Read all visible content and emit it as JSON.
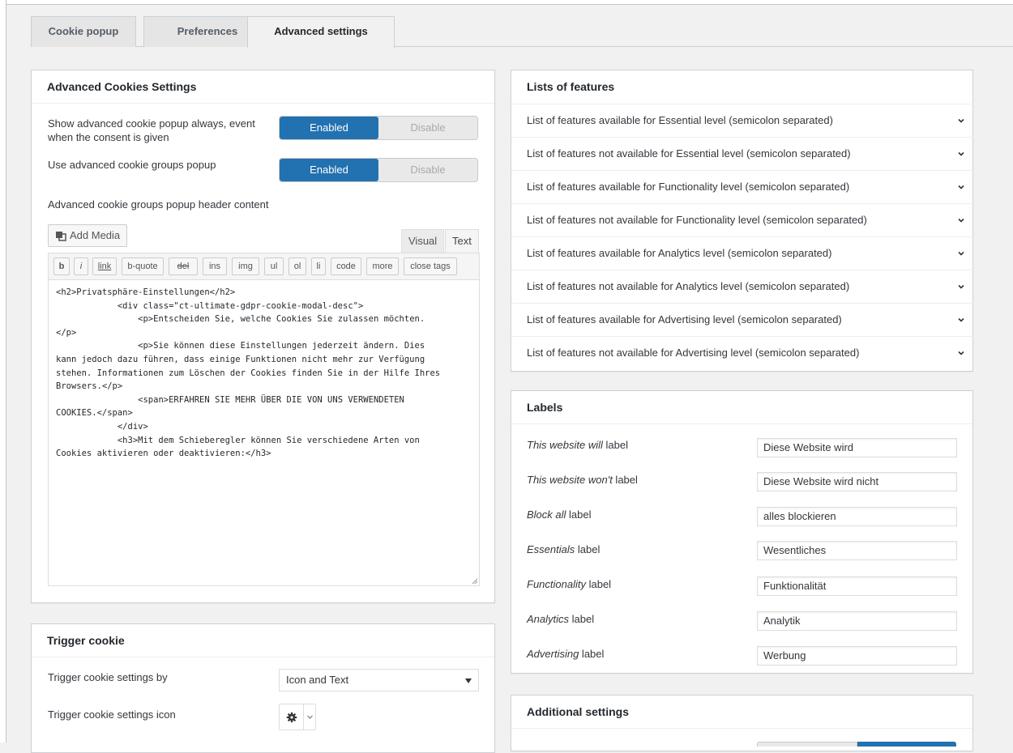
{
  "tabs": [
    {
      "label": "Cookie popup",
      "active": false
    },
    {
      "label": "Preferences",
      "active": false
    },
    {
      "label": "Advanced settings",
      "active": true
    }
  ],
  "advanced_box": {
    "title": "Advanced Cookies Settings",
    "show_popup_always": {
      "label": "Show advanced cookie popup always, event when the consent is given",
      "on_label": "Enabled",
      "off_label": "Disable",
      "value": "Enabled"
    },
    "use_groups_popup": {
      "label": "Use advanced cookie groups popup",
      "on_label": "Enabled",
      "off_label": "Disable",
      "value": "Enabled"
    },
    "header_content_label": "Advanced cookie groups popup header content",
    "editor": {
      "add_media": "Add Media",
      "tab_visual": "Visual",
      "tab_text": "Text",
      "active_tab": "Text",
      "buttons": [
        "b",
        "i",
        "link",
        "b-quote",
        "del",
        "ins",
        "img",
        "ul",
        "ol",
        "li",
        "code",
        "more",
        "close tags"
      ],
      "content": "<h2>Privatsphäre-Einstellungen</h2>\n            <div class=\"ct-ultimate-gdpr-cookie-modal-desc\">\n                <p>Entscheiden Sie, welche Cookies Sie zulassen möchten.\n</p>\n                <p>Sie können diese Einstellungen jederzeit ändern. Dies\nkann jedoch dazu führen, dass einige Funktionen nicht mehr zur Verfügung\nstehen. Informationen zum Löschen der Cookies finden Sie in der Hilfe Ihres\nBrowsers.</p>\n                <span>ERFAHREN SIE MEHR ÜBER DIE VON UNS VERWENDETEN\nCOOKIES.</span>\n            </div>\n            <h3>Mit dem Schieberegler können Sie verschiedene Arten von\nCookies aktivieren oder deaktivieren:</h3>"
    }
  },
  "trigger_box": {
    "title": "Trigger cookie",
    "settings_by_label": "Trigger cookie settings by",
    "settings_by_value": "Icon and Text",
    "icon_label": "Trigger cookie settings icon",
    "icon_value": "gear-icon"
  },
  "features_box": {
    "title": "Lists of features",
    "items": [
      "List of features available for Essential level (semicolon separated)",
      "List of features not available for Essential level (semicolon separated)",
      "List of features available for Functionality level (semicolon separated)",
      "List of features not available for Functionality level (semicolon separated)",
      "List of features available for Analytics level (semicolon separated)",
      "List of features not available for Analytics level (semicolon separated)",
      "List of features available for Advertising level (semicolon separated)",
      "List of features not available for Advertising level (semicolon separated)"
    ]
  },
  "labels_box": {
    "title": "Labels",
    "rows": [
      {
        "name_em": "This website will",
        "name_suffix": " label",
        "value": "Diese Website wird"
      },
      {
        "name_em": "This website won't",
        "name_suffix": " label",
        "value": "Diese Website wird nicht"
      },
      {
        "name_em": "Block all",
        "name_suffix": " label",
        "value": "alles blockieren"
      },
      {
        "name_em": "Essentials",
        "name_suffix": " label",
        "value": "Wesentliches"
      },
      {
        "name_em": "Functionality",
        "name_suffix": " label",
        "value": "Funktionalität"
      },
      {
        "name_em": "Analytics",
        "name_suffix": " label",
        "value": "Analytik"
      },
      {
        "name_em": "Advertising",
        "name_suffix": " label",
        "value": "Werbung"
      }
    ]
  },
  "additional_box": {
    "title": "Additional settings"
  },
  "colors": {
    "accent": "#2271b1",
    "background": "#f1f1f1",
    "border": "#ccd0d4"
  }
}
